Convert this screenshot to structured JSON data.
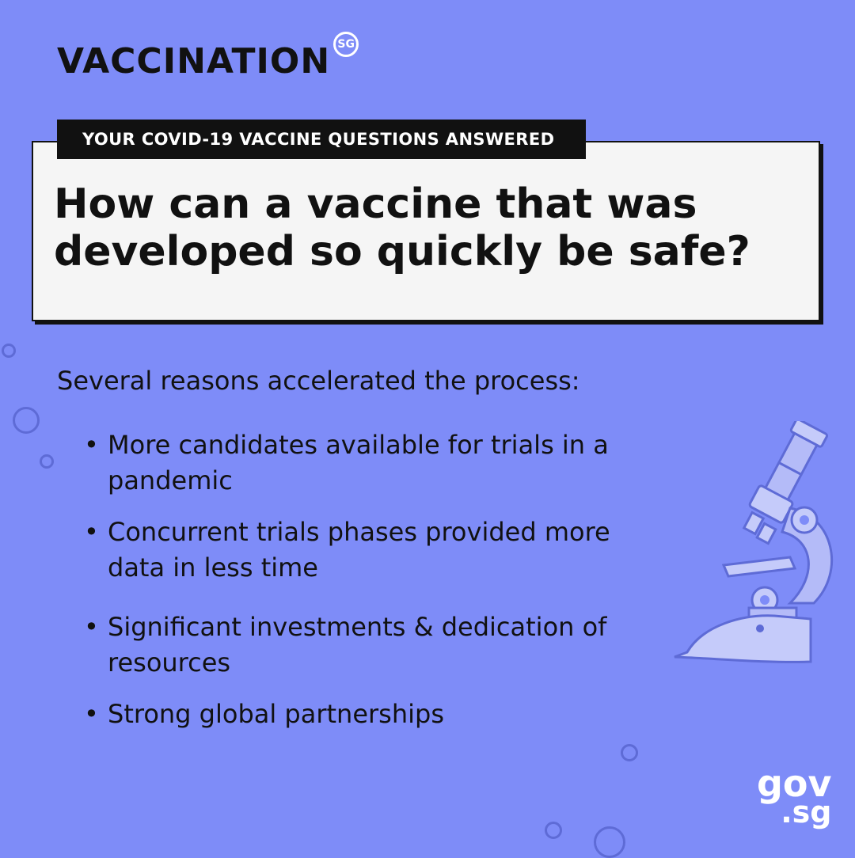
{
  "logo": {
    "wordmark": "VACCINATION",
    "badge": "SG"
  },
  "card": {
    "tag": "YOUR COVID-19 VACCINE QUESTIONS ANSWERED",
    "headline": "How can a vaccine that was developed so quickly be safe?"
  },
  "body": {
    "intro": "Several reasons accelerated the process:",
    "bullets": [
      "More candidates available for trials in a pandemic",
      "Concurrent trials phases provided more data in less time",
      "Significant investments & dedication of resources",
      "Strong global partnerships"
    ]
  },
  "footer": {
    "gov": "gov",
    "sg": ".sg"
  },
  "colors": {
    "background": "#7E8CF8",
    "ink": "#111111",
    "card": "#F5F5F5",
    "accent": "#5E6BD6"
  },
  "icons": [
    "microscope-icon"
  ]
}
